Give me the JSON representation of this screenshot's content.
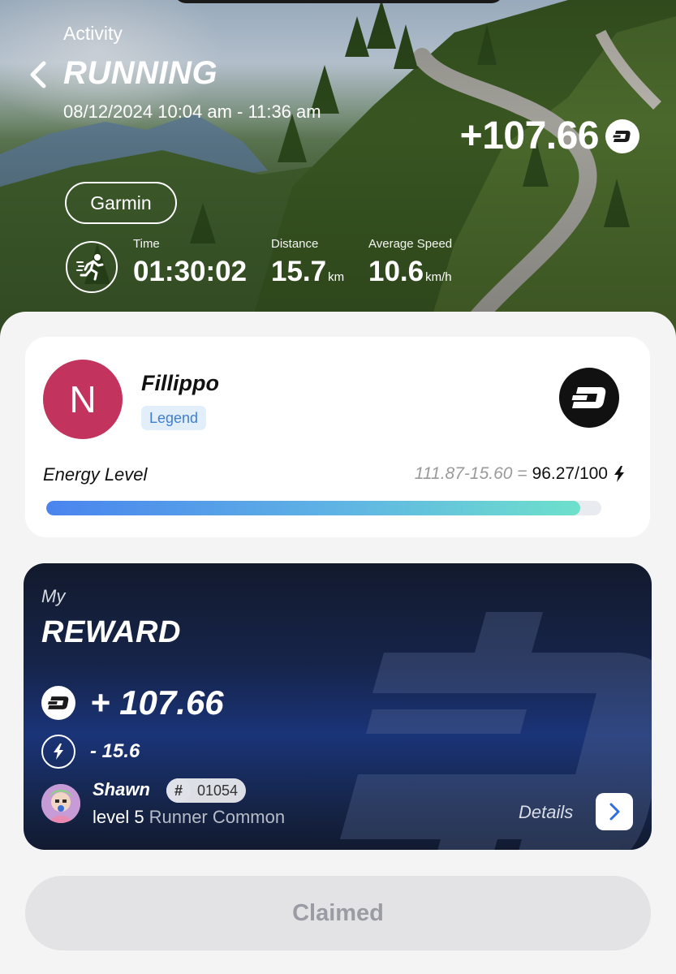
{
  "header": {
    "section_label": "Activity",
    "title": "RUNNING",
    "datetime": "08/12/2024 10:04 am - 11:36 am",
    "reward_total": "+107.66",
    "source": "Garmin"
  },
  "stats": [
    {
      "label": "Time",
      "value": "01:30:02",
      "unit": ""
    },
    {
      "label": "Distance",
      "value": "15.7",
      "unit": "km"
    },
    {
      "label": "Average Speed",
      "value": "10.6",
      "unit": "km/h"
    }
  ],
  "profile": {
    "avatar_initial": "N",
    "avatar_color": "#c2335e",
    "name": "Fillippo",
    "tier": "Legend",
    "energy_label": "Energy Level",
    "energy_formula": "111.87-15.60 =",
    "energy_value": "96.27/100",
    "energy_fraction": 0.9627
  },
  "reward": {
    "prefix": "My",
    "title": "REWARD",
    "token_amount": "+ 107.66",
    "energy_cost": "- 15.6",
    "runner_name": "Shawn",
    "runner_hash": "#",
    "runner_id": "01054",
    "runner_level": "level 5",
    "runner_class": "Runner Common",
    "details_label": "Details"
  },
  "claim_button": "Claimed",
  "colors": {
    "accent_blue": "#4a84ee",
    "accent_teal": "#6ee0cc",
    "card_dark": "#16244a",
    "badge_blue": "#3f7fcf"
  },
  "icons": {
    "back": "chevron-left-icon",
    "token": "dash-coin-icon",
    "run": "running-man-icon",
    "energy": "lightning-icon",
    "details": "chevron-right-icon"
  }
}
